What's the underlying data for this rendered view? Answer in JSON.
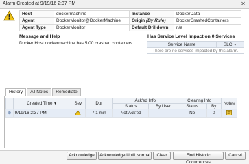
{
  "window": {
    "title": "Alarm Created at 9/19/16 2:37 PM",
    "close_glyph": "✕"
  },
  "props": {
    "host_label": "Host",
    "host_value": "dockermachine",
    "instance_label": "Instance",
    "instance_value": "DockerData",
    "agent_label": "Agent",
    "agent_value": "DockerMonitor@DockerMachine",
    "origin_label": "Origin",
    "origin_rule": "(By Rule)",
    "origin_value": "DockerCrashedContainers",
    "agent_type_label": "Agent Type",
    "agent_type_value": "DockerMonitor",
    "drilldown_label": "Default Drilldown",
    "drilldown_value": "n/a"
  },
  "message": {
    "heading": "Message and Help",
    "text": "Docker Host dockermachine has 5.00 crashed containers"
  },
  "services": {
    "heading": "Has Service Level Impact on",
    "count": "0",
    "count_suffix": "Services",
    "col_name": "Service Name",
    "col_slc": "SLC",
    "empty_text": "There are no services impacted by this alarm."
  },
  "tabs": [
    {
      "label": "History"
    },
    {
      "label": "All Notes"
    },
    {
      "label": "Remediate"
    }
  ],
  "history": {
    "headers": {
      "created": "Created Time",
      "sev": "Sev",
      "dur": "Dur",
      "acked_group": "Ack'ed Info",
      "acked_status": "Status",
      "acked_by": "By User",
      "clearing_group": "Clearing Info",
      "clearing_status": "Status",
      "clearing_by": "By",
      "notes": "Notes"
    },
    "rows": [
      {
        "created": "9/19/16 2:37 PM",
        "dur": "7.1 min",
        "acked_status": "Not Ack'ed",
        "acked_by": "",
        "clearing_status": "No",
        "clearing_by": "0"
      }
    ]
  },
  "buttons": {
    "acknowledge": "Acknowledge",
    "ack_until_normal": "Acknowledge Until Normal",
    "clear": "Clear",
    "find_historic": "Find Historic Occurrences",
    "cancel": "Cancel"
  },
  "colors": {
    "warning": "#f0c419",
    "header_bg": "#eef2f7",
    "row_bg": "#e5ecf6"
  }
}
